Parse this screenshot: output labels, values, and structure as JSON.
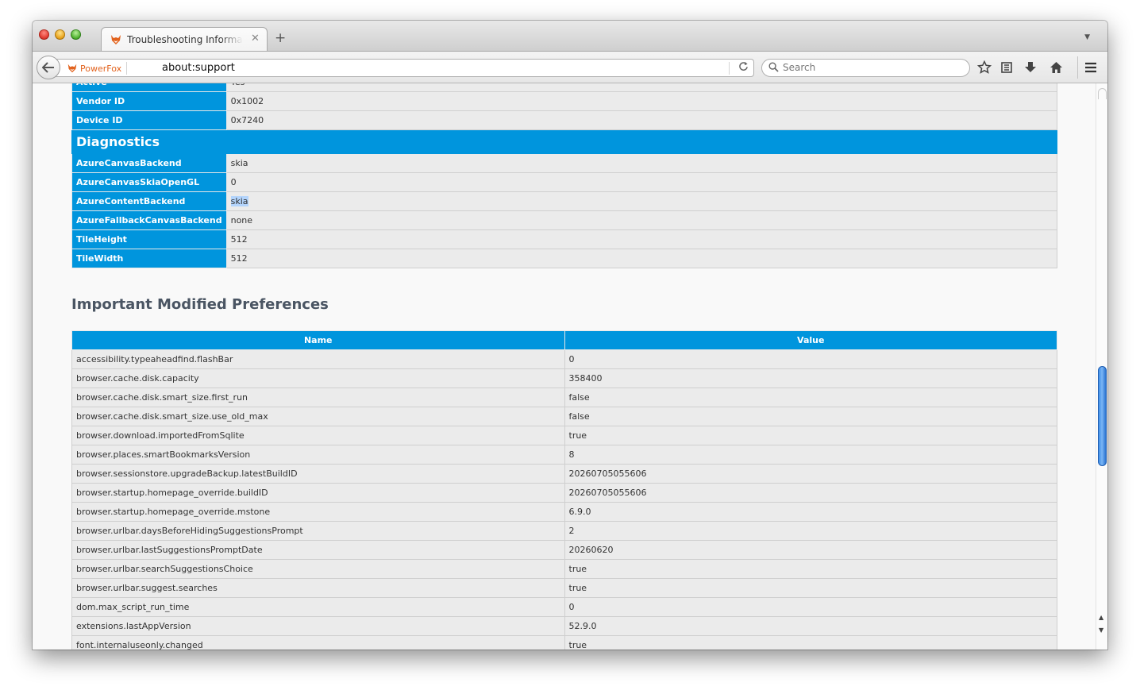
{
  "tab": {
    "title": "Troubleshooting Information",
    "close": "✕"
  },
  "new_tab": "+",
  "nav": {
    "identity_label": "PowerFox",
    "url": "about:support",
    "search_placeholder": "Search"
  },
  "graphics": {
    "rows_top": [
      {
        "key": "Active",
        "value": "Yes"
      },
      {
        "key": "Vendor ID",
        "value": "0x1002"
      },
      {
        "key": "Device ID",
        "value": "0x7240"
      }
    ],
    "diagnostics_title": "Diagnostics",
    "rows_diag": [
      {
        "key": "AzureCanvasBackend",
        "value": "skia"
      },
      {
        "key": "AzureCanvasSkiaOpenGL",
        "value": "0"
      },
      {
        "key": "AzureContentBackend",
        "value": "skia"
      },
      {
        "key": "AzureFallbackCanvasBackend",
        "value": "none"
      },
      {
        "key": "TileHeight",
        "value": "512"
      },
      {
        "key": "TileWidth",
        "value": "512"
      }
    ]
  },
  "prefs": {
    "heading": "Important Modified Preferences",
    "col_name": "Name",
    "col_value": "Value",
    "rows": [
      {
        "name": "accessibility.typeaheadfind.flashBar",
        "value": "0"
      },
      {
        "name": "browser.cache.disk.capacity",
        "value": "358400"
      },
      {
        "name": "browser.cache.disk.smart_size.first_run",
        "value": "false"
      },
      {
        "name": "browser.cache.disk.smart_size.use_old_max",
        "value": "false"
      },
      {
        "name": "browser.download.importedFromSqlite",
        "value": "true"
      },
      {
        "name": "browser.places.smartBookmarksVersion",
        "value": "8"
      },
      {
        "name": "browser.sessionstore.upgradeBackup.latestBuildID",
        "value": "20260705055606"
      },
      {
        "name": "browser.startup.homepage_override.buildID",
        "value": "20260705055606"
      },
      {
        "name": "browser.startup.homepage_override.mstone",
        "value": "6.9.0"
      },
      {
        "name": "browser.urlbar.daysBeforeHidingSuggestionsPrompt",
        "value": "2"
      },
      {
        "name": "browser.urlbar.lastSuggestionsPromptDate",
        "value": "20260620"
      },
      {
        "name": "browser.urlbar.searchSuggestionsChoice",
        "value": "true"
      },
      {
        "name": "browser.urlbar.suggest.searches",
        "value": "true"
      },
      {
        "name": "dom.max_script_run_time",
        "value": "0"
      },
      {
        "name": "extensions.lastAppVersion",
        "value": "52.9.0"
      },
      {
        "name": "font.internaluseonly.changed",
        "value": "true"
      }
    ]
  },
  "icons": {
    "back": "back-arrow-icon",
    "reload": "reload-icon",
    "search": "search-icon",
    "bookmark": "star-icon",
    "library": "library-icon",
    "download": "download-icon",
    "home": "home-icon",
    "menu": "hamburger-menu-icon"
  },
  "colors": {
    "header_blue": "#0095dd",
    "identity_orange": "#e2631e"
  }
}
